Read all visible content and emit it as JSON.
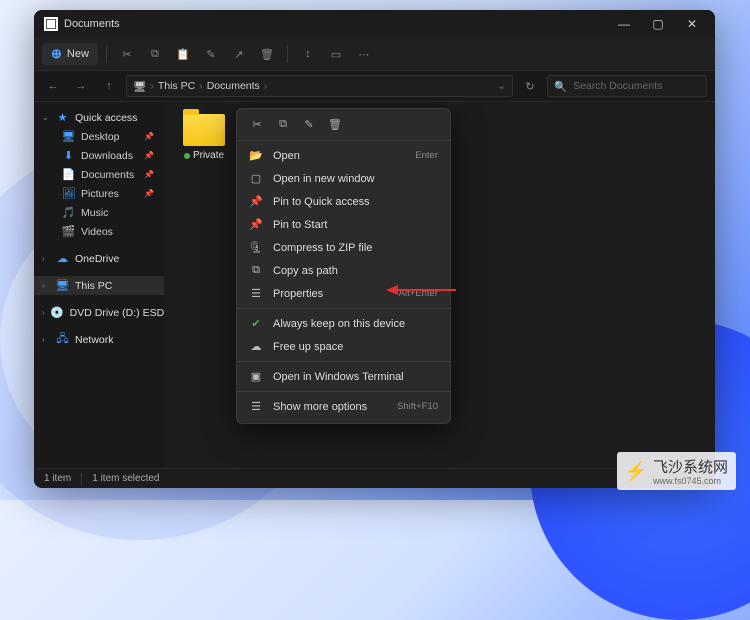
{
  "window": {
    "title": "Documents"
  },
  "titlebar": {
    "min": "—",
    "max": "▢",
    "close": "✕"
  },
  "toolbar": {
    "new": "New"
  },
  "breadcrumb": {
    "root": "This PC",
    "current": "Documents"
  },
  "search": {
    "placeholder": "Search Documents"
  },
  "sidebar": {
    "quick_access": "Quick access",
    "items": [
      {
        "label": "Desktop"
      },
      {
        "label": "Downloads"
      },
      {
        "label": "Documents"
      },
      {
        "label": "Pictures"
      },
      {
        "label": "Music"
      },
      {
        "label": "Videos"
      }
    ],
    "onedrive": "OneDrive",
    "thispc": "This PC",
    "dvd": "DVD Drive (D:) ESD-…",
    "network": "Network"
  },
  "content": {
    "folder": "Private"
  },
  "context": {
    "open": "Open",
    "open_new": "Open in new window",
    "pin_quick": "Pin to Quick access",
    "pin_start": "Pin to Start",
    "compress": "Compress to ZIP file",
    "copy_path": "Copy as path",
    "properties": "Properties",
    "keep": "Always keep on this device",
    "free": "Free up space",
    "terminal": "Open in Windows Terminal",
    "more": "Show more options",
    "sc_enter": "Enter",
    "sc_prop": "Alt+Enter",
    "sc_more": "Shift+F10"
  },
  "status": {
    "count": "1 item",
    "selected": "1 item selected"
  },
  "watermark": {
    "brand": "飞沙系统网",
    "url": "www.fs0745.com"
  }
}
